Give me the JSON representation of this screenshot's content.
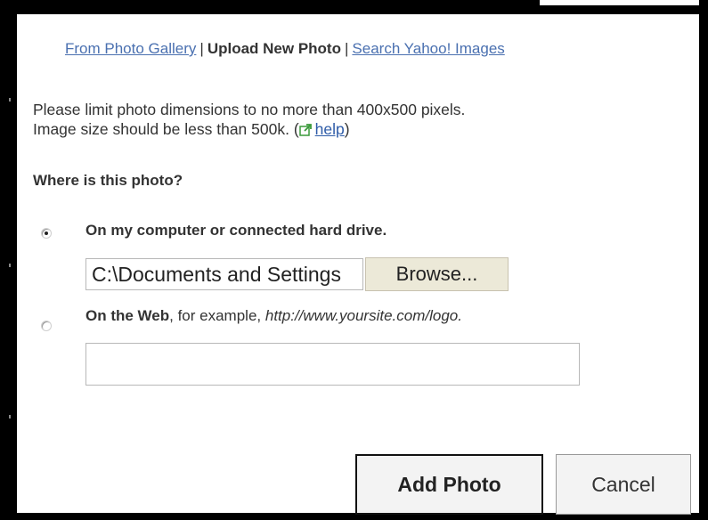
{
  "tabs": {
    "gallery": "From Photo Gallery",
    "separator": "|",
    "upload": "Upload New Photo",
    "search": "Search Yahoo! Images"
  },
  "info": {
    "line1": "Please limit photo dimensions to no more than 400x500 pixels.",
    "line2_prefix": "Image size should be less than 500k. (",
    "help_link": "help",
    "line2_suffix": ")"
  },
  "question": "Where is this photo?",
  "options": {
    "computer": {
      "label": "On my computer or connected hard drive.",
      "selected": true
    },
    "web": {
      "label_bold": "On the Web",
      "label_mid": ", for example, ",
      "label_example": "http://www.yoursite.com/logo.",
      "selected": false
    }
  },
  "file_input": {
    "value": "C:\\Documents and Settings"
  },
  "browse_button": "Browse...",
  "url_input": {
    "value": ""
  },
  "buttons": {
    "add": "Add Photo",
    "cancel": "Cancel"
  },
  "colors": {
    "link": "#4a70b0",
    "text": "#333333",
    "button_face": "#ece9d8"
  },
  "icons": {
    "help": "external-link-icon"
  }
}
